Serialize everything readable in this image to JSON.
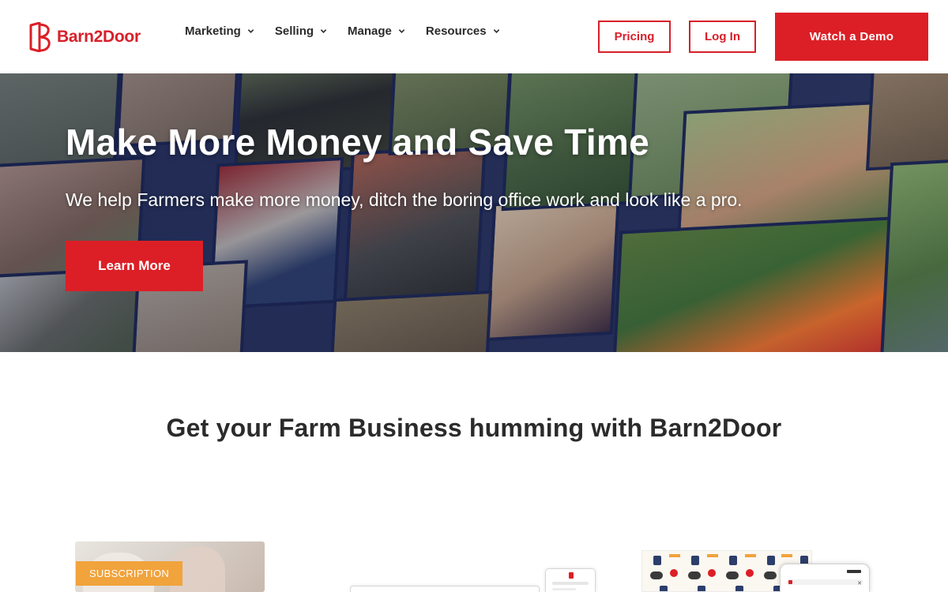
{
  "brand": {
    "name": "Barn2Door",
    "accent": "#dc1f26",
    "icon": "barn2door-logo-icon"
  },
  "nav": {
    "items": [
      {
        "label": "Marketing",
        "icon": "chevron-down-icon"
      },
      {
        "label": "Selling",
        "icon": "chevron-down-icon"
      },
      {
        "label": "Manage",
        "icon": "chevron-down-icon"
      },
      {
        "label": "Resources",
        "icon": "chevron-down-icon"
      }
    ],
    "pricing_label": "Pricing",
    "login_label": "Log In",
    "demo_label": "Watch a Demo"
  },
  "hero": {
    "title": "Make More Money and Save Time",
    "subtitle": "We help Farmers make more money, ditch the boring office work and look like a pro.",
    "cta_label": "Learn More"
  },
  "features": {
    "title": "Get your Farm Business humming with Barn2Door",
    "cards": [
      {
        "tag": "SUBSCRIPTION",
        "tag_color": "#f1a33c"
      }
    ]
  }
}
